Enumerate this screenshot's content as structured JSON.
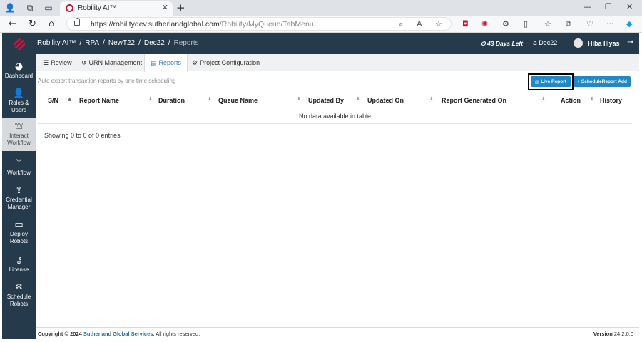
{
  "browser": {
    "tab_title": "Robility AI™",
    "url_host": "https://robilitydev.sutherlandglobal.com",
    "url_path": "/Robility/MyQueue/TabMenu"
  },
  "sidebar": {
    "items": [
      {
        "label": "Dashboard",
        "icon": "pie-chart-icon"
      },
      {
        "label": "Roles & Users",
        "icon": "user-plus-icon"
      },
      {
        "label": "Interact Workflow",
        "icon": "sitemap-icon"
      },
      {
        "label": "Workflow",
        "icon": "branch-icon"
      },
      {
        "label": "Credential Manager",
        "icon": "upload-icon"
      },
      {
        "label": "Deploy Robots",
        "icon": "monitor-icon"
      },
      {
        "label": "License",
        "icon": "key-icon"
      },
      {
        "label": "Schedule Robots",
        "icon": "snowflake-icon"
      }
    ]
  },
  "topbar": {
    "breadcrumb": [
      "Robility AI™",
      "RPA",
      "NewT22",
      "Dec22",
      "Reports"
    ],
    "days_left": "43 Days Left",
    "home_label": "Dec22",
    "user_name": "Hiba Illyas"
  },
  "tabs": [
    {
      "label": "Review",
      "icon": "list-icon"
    },
    {
      "label": "URN Management",
      "icon": "undo-icon"
    },
    {
      "label": "Reports",
      "icon": "report-icon"
    },
    {
      "label": "Project Configuration",
      "icon": "gears-icon"
    }
  ],
  "toolbar": {
    "note": "Auto export transaction reports by one time scheduling",
    "live_report": "Live Report",
    "schedule_add": "ScheduleReport Add"
  },
  "table": {
    "columns": [
      "S/N",
      "Report Name",
      "Duration",
      "Queue Name",
      "Updated By",
      "Updated On",
      "Report Generated On",
      "Action",
      "History"
    ],
    "empty_text": "No data available in table",
    "entries_text": "Showing 0 to 0 of 0 entries"
  },
  "footer": {
    "copyright_prefix": "Copyright © 2024",
    "company": "Sutherland Global Services.",
    "rights": "All rights reserved.",
    "version_label": "Version",
    "version_value": "24.2.0.0"
  },
  "colors": {
    "sidebar_bg": "#253a4a",
    "accent_blue": "#1f88c6",
    "brand_red": "#d0103a"
  }
}
